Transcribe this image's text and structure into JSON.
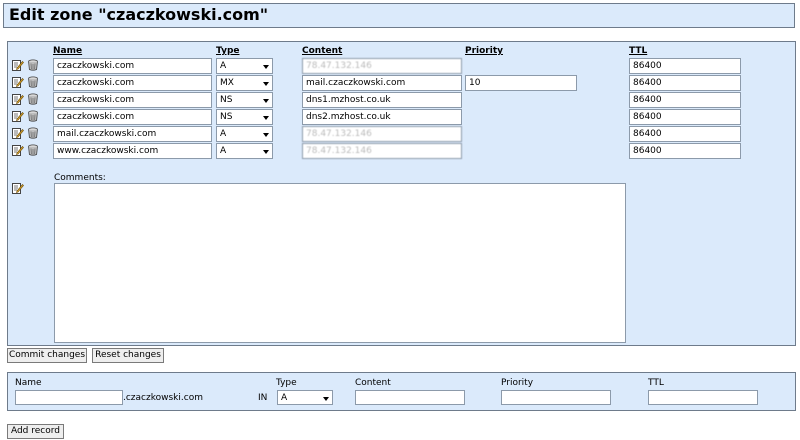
{
  "page": {
    "title": "Edit zone \"czaczkowski.com\""
  },
  "edit_form": {
    "headers": {
      "name": "Name",
      "type": "Type",
      "content": "Content",
      "priority": "Priority",
      "ttl": "TTL"
    },
    "records": [
      {
        "name": "czaczkowski.com",
        "type": "A",
        "content": "78.47.132.146",
        "content_obscured": true,
        "priority": "",
        "ttl": "86400"
      },
      {
        "name": "czaczkowski.com",
        "type": "MX",
        "content": "mail.czaczkowski.com",
        "content_obscured": false,
        "priority": "10",
        "ttl": "86400"
      },
      {
        "name": "czaczkowski.com",
        "type": "NS",
        "content": "dns1.mzhost.co.uk",
        "content_obscured": false,
        "priority": "",
        "ttl": "86400"
      },
      {
        "name": "czaczkowski.com",
        "type": "NS",
        "content": "dns2.mzhost.co.uk",
        "content_obscured": false,
        "priority": "",
        "ttl": "86400"
      },
      {
        "name": "mail.czaczkowski.com",
        "type": "A",
        "content": "78.47.132.146",
        "content_obscured": true,
        "priority": "",
        "ttl": "86400"
      },
      {
        "name": "www.czaczkowski.com",
        "type": "A",
        "content": "78.47.132.146",
        "content_obscured": true,
        "priority": "",
        "ttl": "86400"
      }
    ],
    "comments_label": "Comments:",
    "comments_value": ""
  },
  "buttons": {
    "commit": "Commit changes",
    "reset": "Reset changes",
    "add": "Add record"
  },
  "add_form": {
    "labels": {
      "name": "Name",
      "type": "Type",
      "content": "Content",
      "priority": "Priority",
      "ttl": "TTL"
    },
    "domain_suffix": ".czaczkowski.com",
    "class_label": "IN",
    "type_selected": "A",
    "name_value": "",
    "content_value": "",
    "priority_value": "",
    "ttl_value": ""
  },
  "icons": {
    "edit": "edit-pencil-icon",
    "delete": "delete-bin-icon"
  },
  "colors": {
    "panel_bg": "#dbeafb",
    "panel_border": "#6e7b8b",
    "input_border": "#8c9aaa"
  }
}
